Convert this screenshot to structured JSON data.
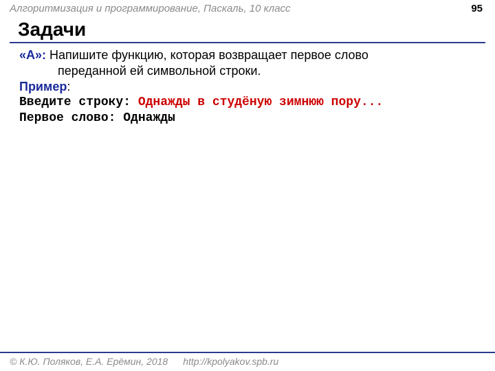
{
  "header": {
    "course": "Алгоритмизация и программирование, Паскаль, 10 класс",
    "page": "95"
  },
  "title": "Задачи",
  "task": {
    "label": "«A»:",
    "line1": " Напишите функцию, которая возвращает первое слово",
    "line2": "переданной ей символьной строки."
  },
  "example": {
    "label": "Пример",
    "colon": ":",
    "prompt": "Введите строку: ",
    "input": "Однажды в студёную зимнюю пору...",
    "result_label": "Первое слово: ",
    "result_value": "Однажды"
  },
  "footer": {
    "copyright": "© К.Ю. Поляков, Е.А. Ерёмин, 2018",
    "url": "http://kpolyakov.spb.ru"
  }
}
